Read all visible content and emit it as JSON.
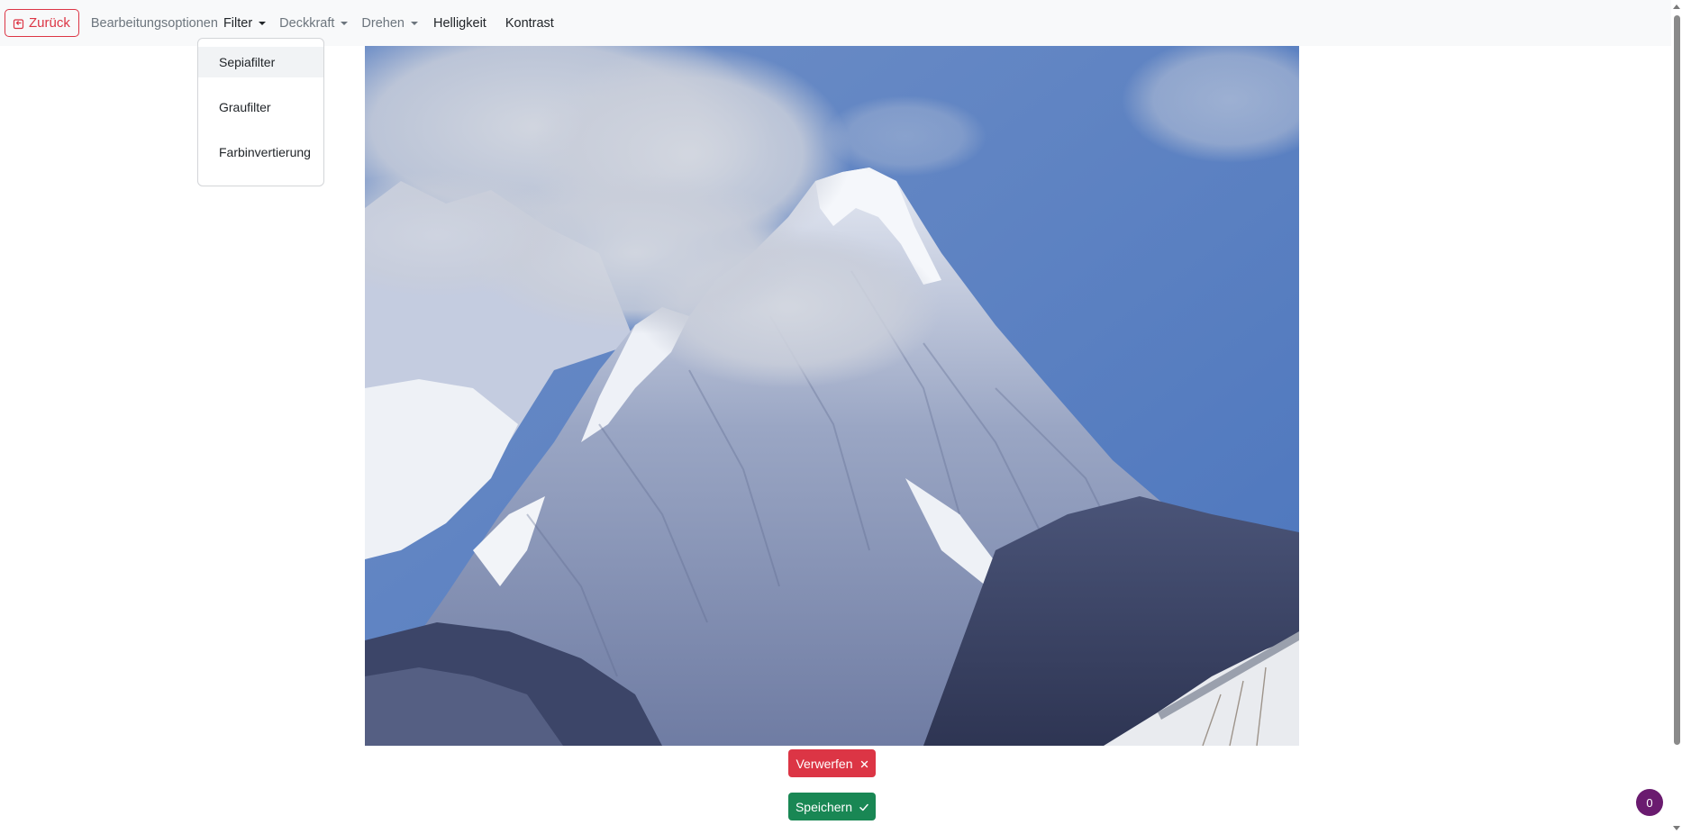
{
  "navbar": {
    "back_label": "Zurück",
    "brand": "Bearbeitungsoptionen",
    "items": [
      {
        "label": "Filter",
        "has_dropdown": true,
        "state": "open"
      },
      {
        "label": "Deckkraft",
        "has_dropdown": true
      },
      {
        "label": "Drehen",
        "has_dropdown": true
      },
      {
        "label": "Helligkeit",
        "has_dropdown": false
      },
      {
        "label": "Kontrast",
        "has_dropdown": false
      }
    ]
  },
  "filter_menu": {
    "items": [
      "Sepiafilter",
      "Graufilter",
      "Farbinvertierung"
    ],
    "highlighted": "Sepiafilter"
  },
  "actions": {
    "discard_label": "Verwerfen",
    "save_label": "Speichern"
  },
  "badge": {
    "count": "0"
  },
  "icons": {
    "back": "back-arrow-icon",
    "discard": "close-icon",
    "save": "checkmark-icon",
    "dropdown": "caret-down-icon"
  },
  "colors": {
    "danger": "#dc3545",
    "success": "#198754",
    "badge": "#6a1b6f",
    "navbar_bg": "#f8f9fa"
  }
}
